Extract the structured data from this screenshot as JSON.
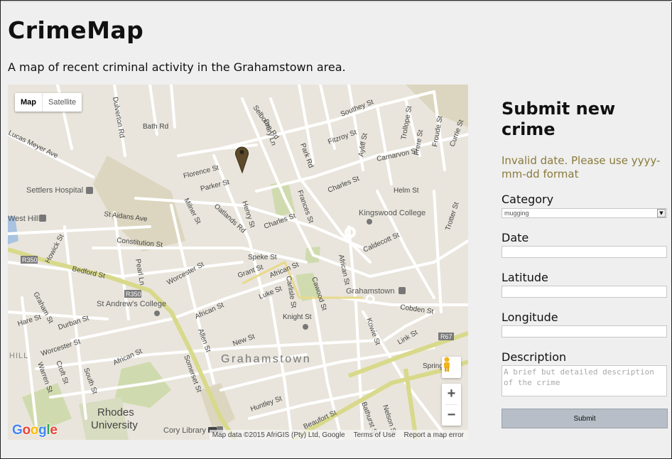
{
  "page": {
    "title": "CrimeMap",
    "subtitle": "A map of recent criminal activity in the Grahamstown area."
  },
  "map": {
    "type_buttons": {
      "map": "Map",
      "satellite": "Satellite"
    },
    "google_logo": "Google",
    "attribution": {
      "data": "Map data ©2015 AfriGIS (Pty) Ltd, Google",
      "terms": "Terms of Use",
      "report": "Report a map error"
    },
    "zoom": {
      "in": "+",
      "out": "−"
    },
    "labels": {
      "town": "Grahamstown",
      "rhodes1": "Rhodes",
      "rhodes2": "University",
      "settlers": "Settlers Hospital",
      "kingswood": "Kingswood College",
      "standrews": "St Andrew's College",
      "grahamstown_poi": "Grahamstown",
      "cory": "Cory Library",
      "westhill": "West Hill",
      "hill": "HILL",
      "r350a": "R350",
      "r350b": "R350",
      "r67": "R67",
      "selborne": "Selborne Rd",
      "southey": "Southey St",
      "bath": "Bath Rd",
      "dulverton": "Dulverton Rd",
      "lucas": "Lucas Meyer Ave",
      "florence": "Florence St",
      "parker": "Parker St",
      "drury": "Drury Ln",
      "park": "Park Rd",
      "fitzroy": "Fitzroy St",
      "ayliff": "Ayliff St",
      "carnarvon": "Carnarvon St",
      "trollope": "Trollope St",
      "frere": "Frere St",
      "froude": "Froude St",
      "currie": "Currie St",
      "charles": "Charles St",
      "charles2": "Charles St",
      "helm": "Helm St",
      "frances": "Frances St",
      "staidans": "St Aidans Ave",
      "milner": "Milner St",
      "oatlands": "Oatlands Rd",
      "henry": "Henry St",
      "caldecott": "Caldecott St",
      "trotter": "Trotter St",
      "constitution": "Constitution St",
      "howick": "Howick St",
      "bedford": "Bedford St",
      "pearl": "Pearl Ln",
      "worcester": "Worcester St",
      "worcester2": "Worcester St",
      "speke": "Speke St",
      "grant": "Grant St",
      "african": "African St",
      "african2": "African St",
      "african3": "African St",
      "african4": "African St",
      "luke": "Luke St",
      "carlisle": "Carlisle St",
      "cawood": "Cawood St",
      "cobden": "Cobden St",
      "graham": "Graham St",
      "hare": "Hare St",
      "durban": "Durban St",
      "knight": "Knight St",
      "allen": "Allen St",
      "new": "New St",
      "kowie": "Kowie St",
      "link": "Link St",
      "warren": "Warren St",
      "croft": "Croft St",
      "south": "South St",
      "somerset": "Somerset St",
      "huntley": "Huntley St",
      "beaufort": "Beaufort St",
      "bathurst": "Bathurst St",
      "nelson": "Nelson St",
      "spring": "Spring"
    }
  },
  "form": {
    "title": "Submit new crime",
    "error": "Invalid date. Please use yyyy-mm-dd format",
    "category_label": "Category",
    "category_value": "mugging",
    "date_label": "Date",
    "latitude_label": "Latitude",
    "longitude_label": "Longitude",
    "description_label": "Description",
    "description_placeholder": "A brief but detailed description of the crime",
    "submit_label": "Submit"
  }
}
